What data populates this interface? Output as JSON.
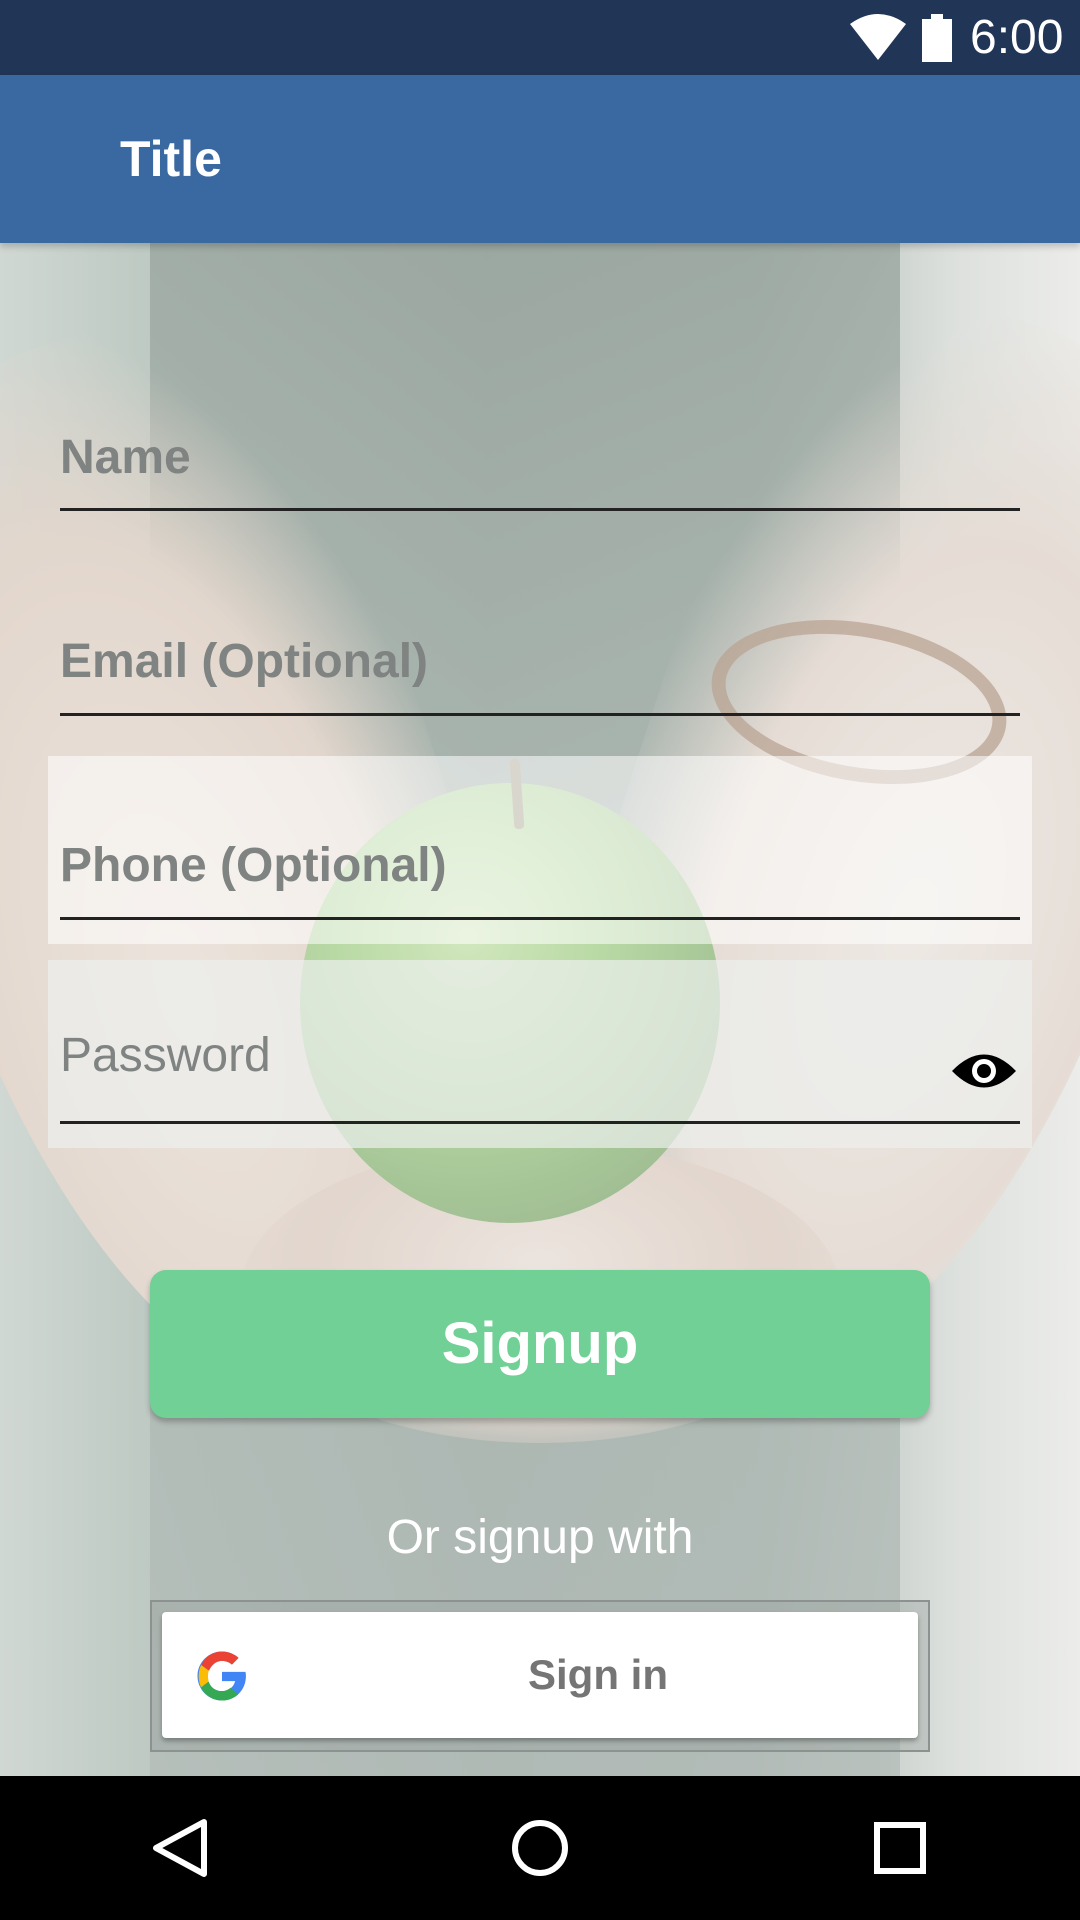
{
  "status_bar": {
    "time": "6:00",
    "icons": [
      "wifi-icon",
      "battery-icon"
    ]
  },
  "app_bar": {
    "title": "Title"
  },
  "form": {
    "name_label": "Name",
    "email_label": "Email (Optional)",
    "phone_label": "Phone (Optional)",
    "password_label": "Password",
    "password_toggle_icon": "eye-icon"
  },
  "actions": {
    "signup_label": "Signup",
    "or_text": "Or signup with",
    "google_signin_label": "Sign in",
    "google_icon": "google-g-icon"
  },
  "nav_bar": {
    "icons": [
      "back-icon",
      "home-icon",
      "recents-icon"
    ]
  },
  "colors": {
    "status_bar": "#213557",
    "app_bar": "#3a68a1",
    "signup_button": "#70d095",
    "nav_bar": "#000000"
  }
}
